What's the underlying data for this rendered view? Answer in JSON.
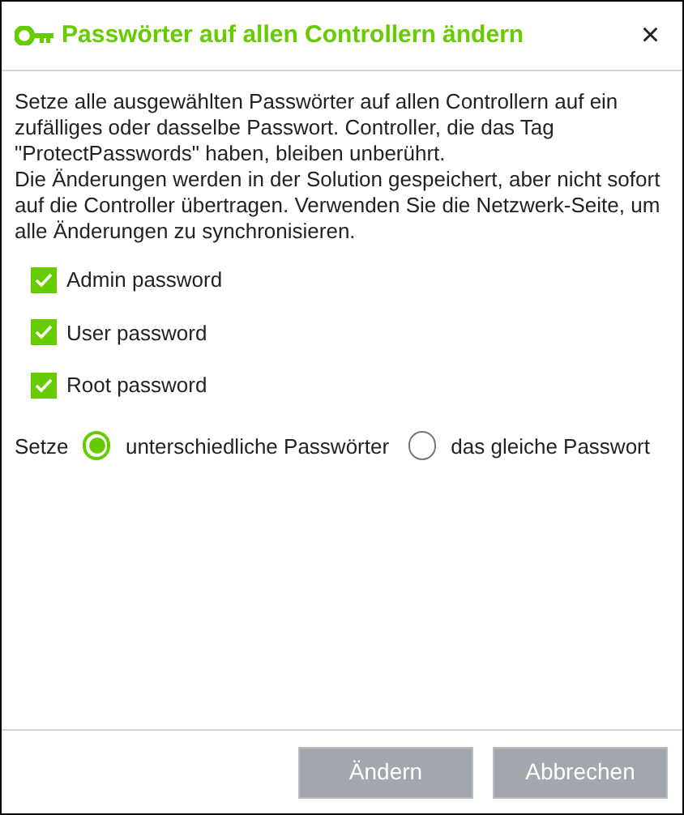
{
  "window": {
    "title": "Passwörter auf allen Controllern ändern",
    "close": "×"
  },
  "description": [
    "Setze alle ausgewählten Passwörter auf allen Controllern auf ein zufälliges oder dasselbe Passwort. Controller, die das Tag \"ProtectPasswords\" haben, bleiben unberührt.",
    "Die Änderungen werden in der Solution gespeichert, aber nicht sofort auf die Controller übertragen. Verwenden Sie die Netzwerk-Seite, um alle Änderungen zu synchronisieren."
  ],
  "checkboxes": [
    {
      "label": "Admin password",
      "checked": true
    },
    {
      "label": "User password",
      "checked": true
    },
    {
      "label": "Root password",
      "checked": true
    }
  ],
  "mode": {
    "label": "Setze",
    "options": [
      {
        "label": "unterschiedliche Passwörter",
        "selected": true
      },
      {
        "label": "das gleiche Passwort",
        "selected": false
      }
    ]
  },
  "buttons": [
    {
      "label": "Ändern",
      "disabled": true
    },
    {
      "label": "Abbrechen",
      "disabled": true
    }
  ]
}
